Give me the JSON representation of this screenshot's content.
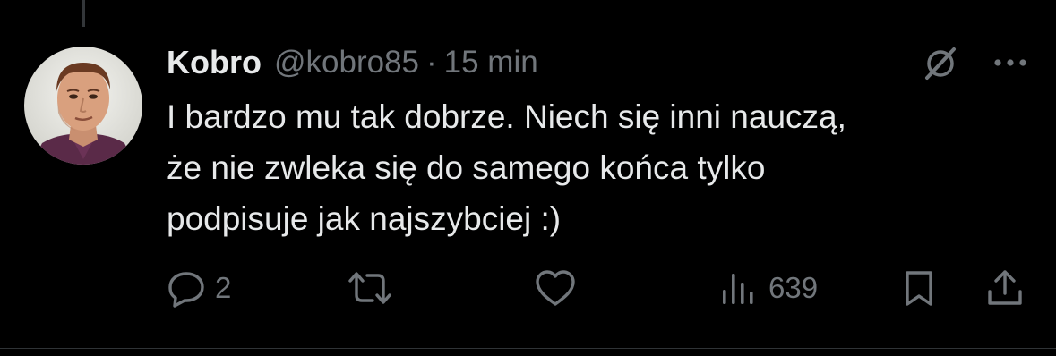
{
  "tweet": {
    "author": {
      "display_name": "Kobro",
      "handle": "@kobro85"
    },
    "separator": "·",
    "timestamp": "15 min",
    "text": "I bardzo mu tak dobrze. Niech się inni nauczą,\nże nie zwleka się do samego końca tylko\npodpisuje jak najszybciej :)",
    "header_icons": [
      "grok-icon",
      "more-icon"
    ]
  },
  "actions": {
    "reply": {
      "icon": "reply-icon",
      "count": "2"
    },
    "repost": {
      "icon": "repost-icon",
      "count": ""
    },
    "like": {
      "icon": "heart-icon",
      "count": ""
    },
    "views": {
      "icon": "views-icon",
      "count": "639"
    },
    "bookmark": {
      "icon": "bookmark-icon"
    },
    "share": {
      "icon": "share-icon"
    }
  },
  "colors": {
    "background": "#000000",
    "primary_text": "#e7e9ea",
    "secondary_text": "#71767b",
    "divider": "#2f3336"
  }
}
